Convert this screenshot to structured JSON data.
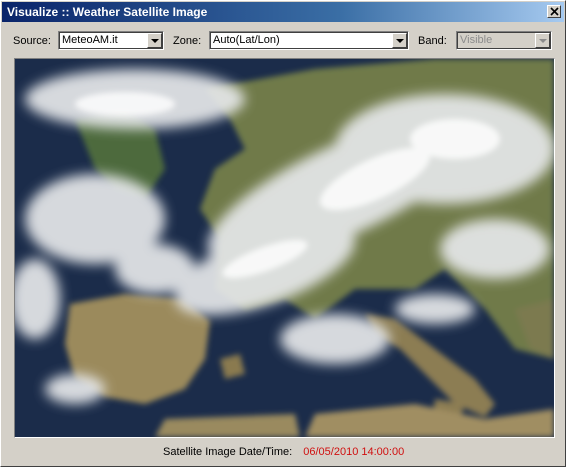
{
  "window": {
    "title": "Visualize :: Weather Satellite Image",
    "close_icon": "close-icon"
  },
  "controls": {
    "source_label": "Source:",
    "source_value": "MeteoAM.it",
    "zone_label": "Zone:",
    "zone_value": "Auto(Lat/Lon)",
    "band_label": "Band:",
    "band_value": "Visible"
  },
  "status": {
    "label": "Satellite Image Date/Time:",
    "datetime": "06/05/2010 14:00:00"
  },
  "colors": {
    "date_text": "#d01010",
    "titlebar_start": "#0a246a",
    "titlebar_end": "#a6caf0"
  }
}
